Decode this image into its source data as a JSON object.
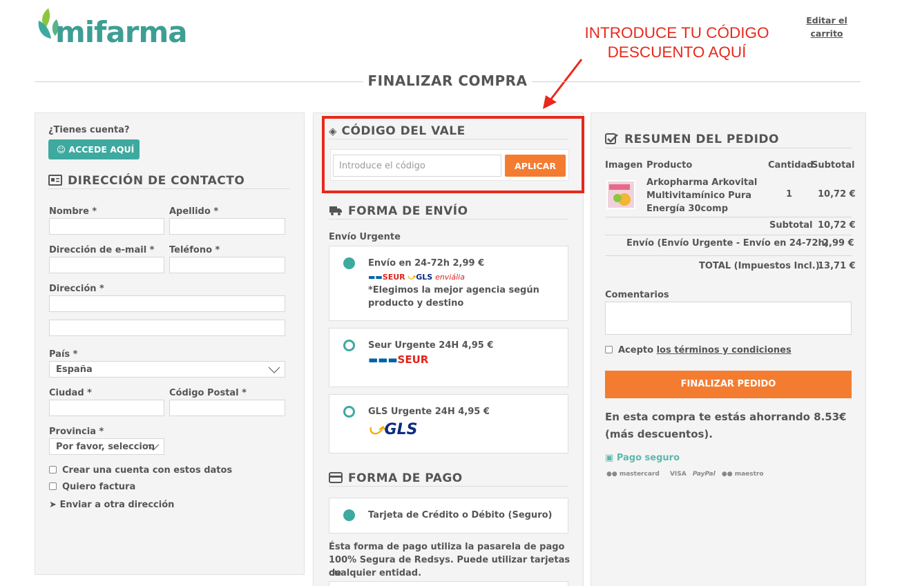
{
  "brand": {
    "name": "mifarma",
    "teal": "#3ea99f",
    "orange": "#f47c30",
    "red": "#e8291c"
  },
  "header": {
    "edit_cart": "Editar el carrito"
  },
  "annotation": {
    "line1": "INTRODUCE TU CÓDIGO",
    "line2": "DESCUENTO AQUÍ"
  },
  "page_title": "FINALIZAR COMPRA",
  "contact": {
    "have_account": "¿Tienes cuenta?",
    "login_button": "ACCEDE AQUÍ",
    "title": "DIRECCIÓN DE CONTACTO",
    "fields": {
      "nombre": "Nombre *",
      "apellido": "Apellido *",
      "email": "Dirección de e-mail *",
      "telefono": "Teléfono *",
      "direccion": "Dirección *",
      "pais": "País *",
      "pais_value": "España",
      "ciudad": "Ciudad *",
      "codigo_postal": "Código Postal *",
      "provincia": "Provincia *",
      "provincia_value": "Por favor, seleccion"
    },
    "create_account": "Crear una cuenta con estos datos",
    "want_invoice": "Quiero factura",
    "send_other": "Enviar a otra dirección"
  },
  "voucher": {
    "title": "CÓDIGO DEL VALE",
    "placeholder": "Introduce el código",
    "apply": "APLICAR"
  },
  "shipping": {
    "title": "FORMA DE ENVÍO",
    "group": "Envío Urgente",
    "options": [
      {
        "label": "Envío en 24-72h 2,99 €",
        "carriers": "SEUR / GLS / enviália",
        "note_line1": "*Elegimos la mejor agencia según",
        "note_line2": "producto y destino",
        "selected": true
      },
      {
        "label": "Seur Urgente 24H 4,95 €",
        "carrier": "SEUR",
        "selected": false
      },
      {
        "label": "GLS Urgente 24H 4,95 €",
        "carrier": "GLS",
        "selected": false
      }
    ]
  },
  "payment": {
    "title": "FORMA DE PAGO",
    "option": "Tarjeta de Crédito o Débito (Seguro)",
    "description_line1": "Ésta forma de pago utiliza la pasarela de pago",
    "description_line2": "100% Segura de Redsys. Puede utilizar tarjetas de",
    "description_line3": "cualquier entidad."
  },
  "summary": {
    "title": "RESUMEN DEL PEDIDO",
    "headers": {
      "image": "Imagen",
      "product": "Producto",
      "qty": "Cantidad",
      "subtotal": "Subtotal"
    },
    "item": {
      "line1": "Arkopharma Arkovital",
      "line2": "Multivitamínico Pura",
      "line3": "Energía 30comp",
      "qty": "1",
      "price": "10,72 €"
    },
    "subtotal_label": "Subtotal",
    "subtotal_value": "10,72 €",
    "shipping_label": "Envío (Envío Urgente - Envío en 24-72h)",
    "shipping_value": "2,99 €",
    "total_label": "TOTAL (Impuestos Incl.)",
    "total_value": "13,71 €",
    "comments_label": "Comentarios",
    "accept_prefix": "Acepto",
    "terms_link": "los términos y condiciones",
    "finish_button": "FINALIZAR PEDIDO",
    "savings_line1": "En esta compra te estás ahorrando 8.53€",
    "savings_line2": "(más descuentos).",
    "secure_label": "Pago seguro",
    "cards": [
      "mastercard",
      "VISA",
      "PayPal",
      "maestro"
    ]
  }
}
